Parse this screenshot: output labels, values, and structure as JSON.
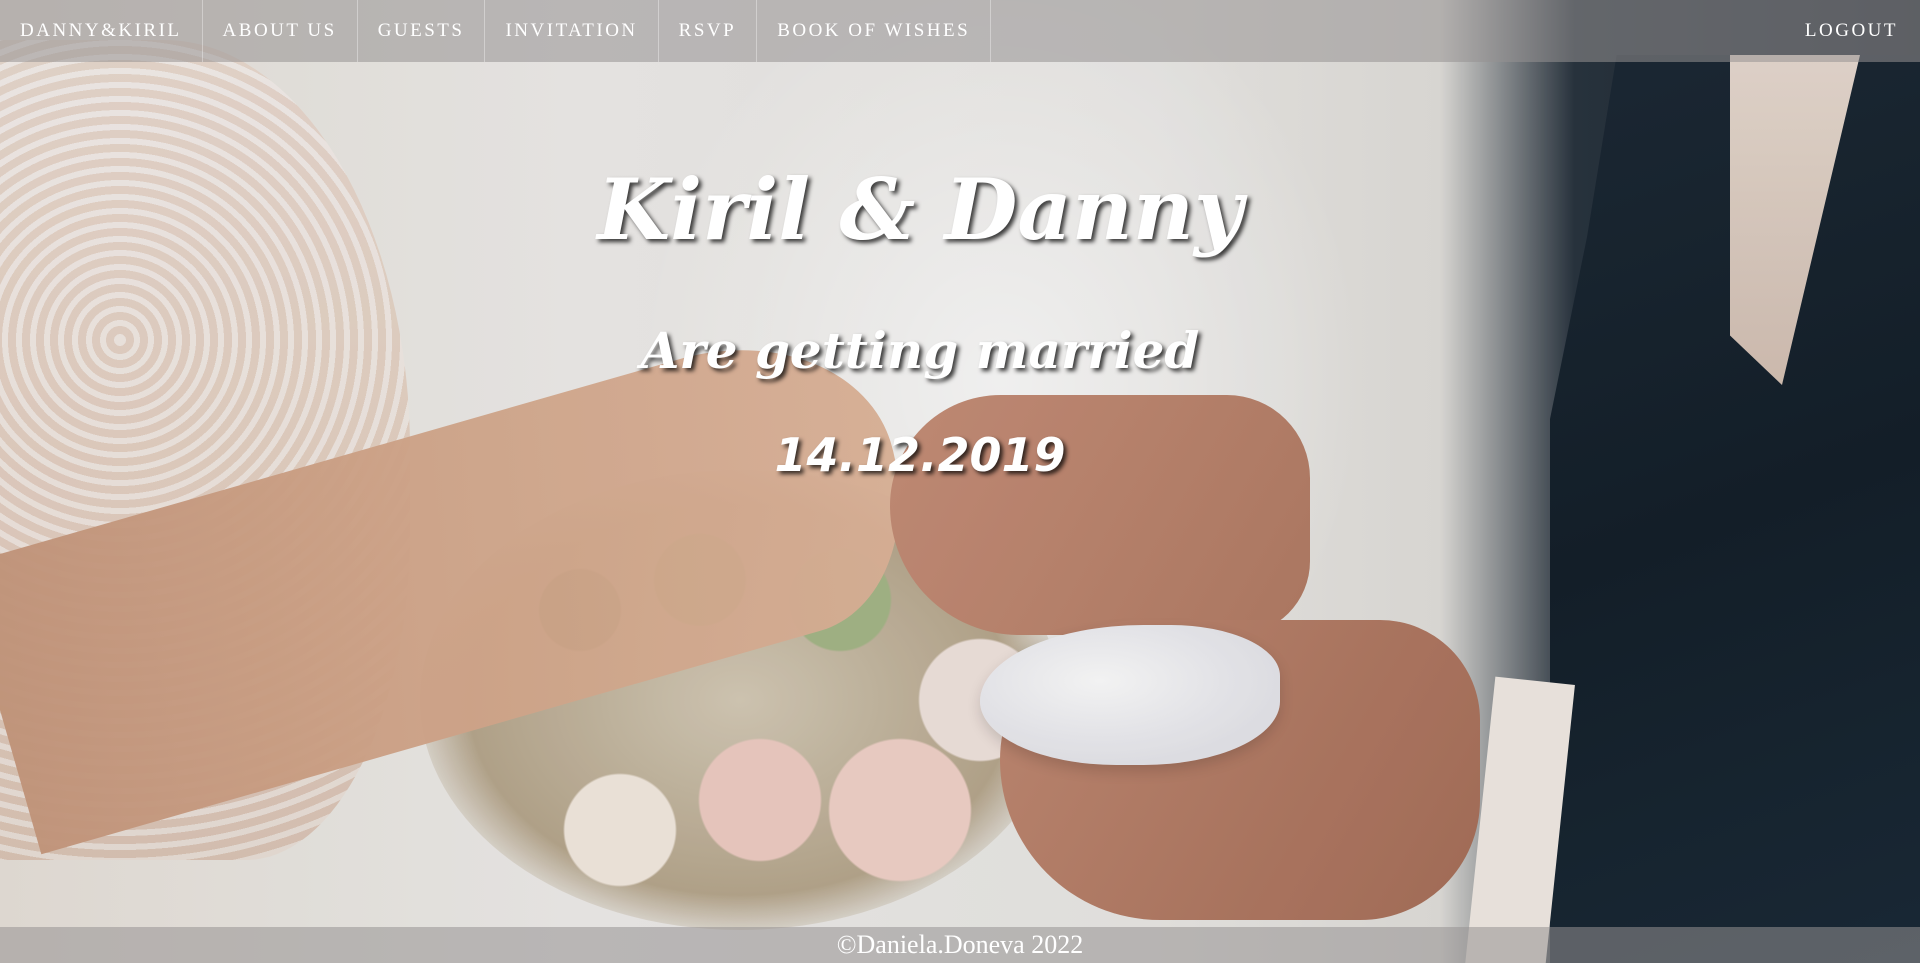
{
  "nav": {
    "brand": "DANNY&KIRIL",
    "items": [
      {
        "label": "ABOUT US"
      },
      {
        "label": "GUESTS"
      },
      {
        "label": "INVITATION"
      },
      {
        "label": "RSVP"
      },
      {
        "label": "BOOK OF WISHES"
      }
    ],
    "logout": "LOGOUT"
  },
  "hero": {
    "title": "Kiril & Danny",
    "subtitle": "Are getting married",
    "date": "14.12.2019"
  },
  "footer": {
    "copyright": "©Daniela.Doneva 2022"
  },
  "colors": {
    "nav_bg": "#969191",
    "text": "#ffffff"
  }
}
